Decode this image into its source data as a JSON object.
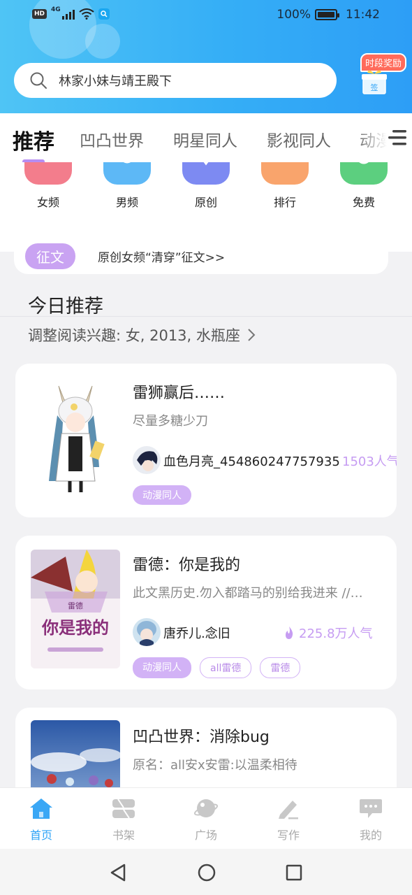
{
  "status_bar": {
    "badge": "HD",
    "network": "4G",
    "battery": "100%",
    "time": "11:42"
  },
  "search": {
    "text": "林家小妹与靖王殿下"
  },
  "checkin": {
    "badge": "时段奖励",
    "gift_label": "签"
  },
  "tabs": [
    {
      "label": "推荐",
      "active": true
    },
    {
      "label": "凹凸世界"
    },
    {
      "label": "明星同人"
    },
    {
      "label": "影视同人"
    },
    {
      "label": "动漫"
    }
  ],
  "categories": [
    {
      "label": "女频",
      "color": "#f37d8c"
    },
    {
      "label": "男频",
      "color": "#5db8f6"
    },
    {
      "label": "原创",
      "color": "#7d8af2"
    },
    {
      "label": "排行",
      "color": "#f9a46c"
    },
    {
      "label": "免费",
      "color": "#5ccf7f"
    }
  ],
  "contest": {
    "tag": "征文",
    "text": "原创女频“清穿”征文>>"
  },
  "today": {
    "title": "今日推荐",
    "prefs": "调整阅读兴趣: 女, 2013, 水瓶座"
  },
  "books": [
    {
      "title": "雷狮赢后……",
      "desc": "尽量多糖少刀",
      "author": "血色月亮_454860247757935",
      "popularity": "1503人气",
      "hot": false,
      "tags": [
        {
          "label": "动漫同人",
          "style": "solid"
        }
      ]
    },
    {
      "title": "雷德：你是我的",
      "desc": "此文黑历史.勿入都踏马的别给我进来 //…",
      "author": "唐乔儿.念旧",
      "popularity": "225.8万人气",
      "hot": true,
      "cover_text": "你是我的",
      "cover_sub": "雷德",
      "tags": [
        {
          "label": "动漫同人",
          "style": "solid"
        },
        {
          "label": "all雷德",
          "style": "outline"
        },
        {
          "label": "雷德",
          "style": "outline"
        }
      ]
    },
    {
      "title": "凹凸世界：消除bug",
      "desc": "原名：all安x安雷:以温柔相待"
    }
  ],
  "bottom_nav": [
    {
      "label": "首页",
      "icon": "home-icon",
      "active": true
    },
    {
      "label": "书架",
      "icon": "bookshelf-icon"
    },
    {
      "label": "广场",
      "icon": "planet-icon"
    },
    {
      "label": "写作",
      "icon": "pen-icon"
    },
    {
      "label": "我的",
      "icon": "chat-bubble-icon"
    }
  ],
  "colors": {
    "accent": "#2ea3f6",
    "purple": "#c69cf2",
    "header_start": "#4fc4f5",
    "header_end": "#2d9ef6"
  }
}
